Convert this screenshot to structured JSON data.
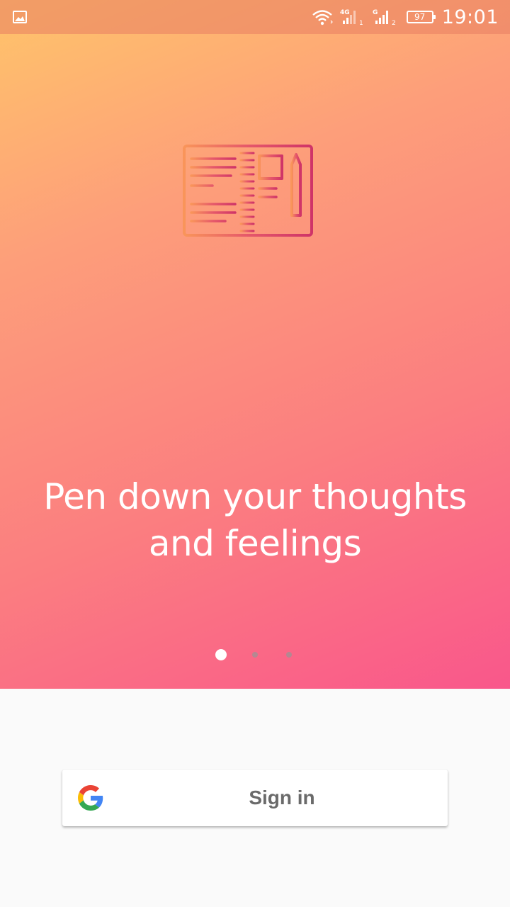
{
  "status_bar": {
    "left_icon": "image-icon",
    "network_1": "4G",
    "sim_1": "1",
    "network_2": "G",
    "sim_2": "2",
    "battery": "97",
    "time": "19:01"
  },
  "hero": {
    "illustration_icon": "notebook-pen-icon",
    "headline_line1": "Pen down your thoughts",
    "headline_line2": "and feelings",
    "pager": {
      "total": 3,
      "active": 1
    }
  },
  "signin": {
    "icon": "google-icon",
    "label": "Sign in"
  },
  "colors": {
    "gradient_start": "#ffc46a",
    "gradient_end": "#f9578b",
    "icon_stroke": "#d13a6a",
    "button_text": "#6a6a6a",
    "background": "#fafafa"
  }
}
